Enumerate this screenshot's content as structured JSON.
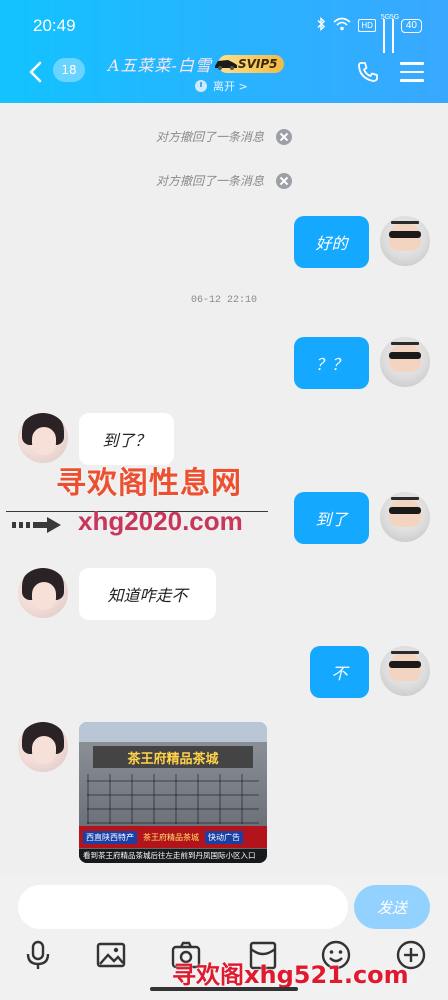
{
  "status_bar": {
    "time": "20:49",
    "hd_badge": "HD",
    "signal1_label": "5G",
    "signal2_label": "5G",
    "battery": "40",
    "icons": [
      "bluetooth-icon",
      "wifi-icon",
      "signal-icon",
      "battery-icon"
    ]
  },
  "header": {
    "back_icon": "chevron-left-icon",
    "unread_count": "18",
    "title": "A五菜菜-白雪",
    "vip_label": "SVIP5",
    "presence": "离开 >",
    "phone_icon": "phone-icon",
    "menu_icon": "menu-icon",
    "gradient": [
      "#12c3ff",
      "#38a8ff"
    ]
  },
  "chat": {
    "recall_1": "对方撤回了一条消息",
    "recall_2": "对方撤回了一条消息",
    "timestamp": "06-12 22:10",
    "messages": [
      {
        "side": "out",
        "text": "好的"
      },
      {
        "side": "out",
        "text": "？？"
      },
      {
        "side": "in",
        "text": "到了？"
      },
      {
        "side": "out",
        "text": "到了"
      },
      {
        "side": "in",
        "text": "知道咋走不"
      },
      {
        "side": "out",
        "text": "不"
      }
    ],
    "image": {
      "sign_text": "茶王府精品茶城",
      "shop_left": "西直陕西特产",
      "shop_mid": "茶王府精品茶城",
      "shop_right": "快动广告",
      "caption": "看到茶王府精品茶城后往左走前到丹凤国际小区入口"
    }
  },
  "watermark": {
    "cn": "寻欢阁性息网",
    "url": "xhg2020.com",
    "bottom": "寻欢阁xhg521.com"
  },
  "input": {
    "placeholder": "",
    "send_label": "发送"
  },
  "toolbar": [
    "mic-icon",
    "image-icon",
    "camera-icon",
    "red-packet-icon",
    "emoji-icon",
    "plus-icon"
  ],
  "colors": {
    "outgoing_bubble": "#14a8ff",
    "incoming_bubble": "#ffffff",
    "send_button": "#93d2ff"
  }
}
